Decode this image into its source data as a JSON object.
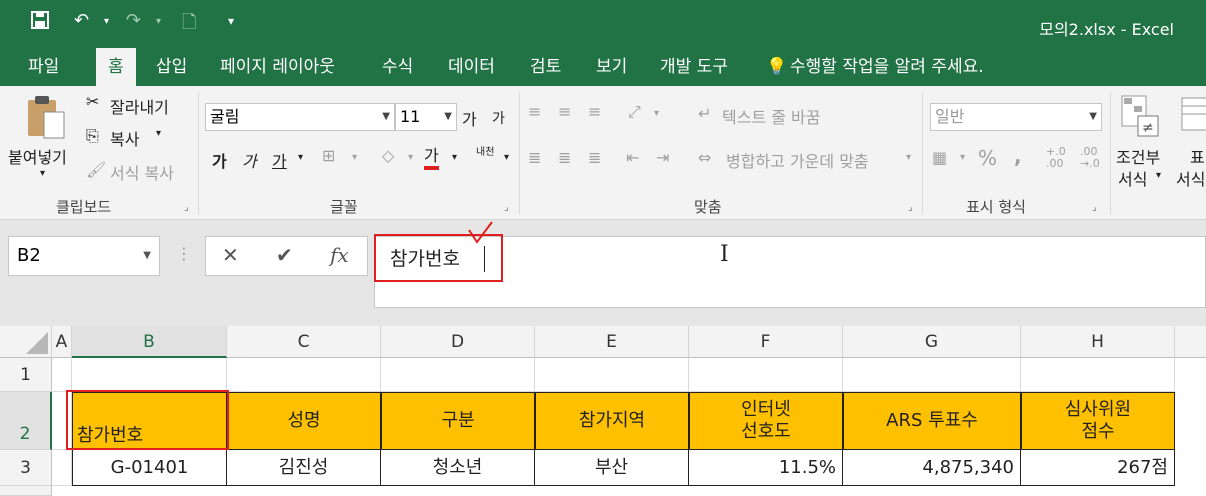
{
  "window": {
    "title": "모의2.xlsx - Excel"
  },
  "quick_access": {
    "save_icon": "save-icon",
    "undo_icon": "undo-icon",
    "redo_icon": "redo-icon",
    "preview_icon": "print-preview-icon",
    "customize_icon": "customize-icon"
  },
  "tabs": [
    "파일",
    "홈",
    "삽입",
    "페이지 레이아웃",
    "수식",
    "데이터",
    "검토",
    "보기",
    "개발 도구"
  ],
  "tell_me": "수행할 작업을 알려 주세요.",
  "ribbon": {
    "clipboard": {
      "paste": "붙여넣기",
      "cut": "잘라내기",
      "copy": "복사",
      "format_painter": "서식 복사",
      "label": "클립보드"
    },
    "font": {
      "name": "굴림",
      "size": "11",
      "grow": "가",
      "shrink": "가",
      "bold": "가",
      "italic": "가",
      "underline": "가",
      "font_color": "가",
      "phonetic": "내천",
      "label": "글꼴"
    },
    "alignment": {
      "wrap_text": "텍스트 줄 바꿈",
      "merge_center": "병합하고 가운데 맞춤",
      "label": "맞춤"
    },
    "number": {
      "format": "일반",
      "percent": "%",
      "comma": ",",
      "inc_decimal": "+.0 .00",
      "dec_decimal": ".00 →.0",
      "label": "표시 형식"
    },
    "styles": {
      "conditional_line1": "조건부",
      "conditional_line2": "서식",
      "table_line1": "표",
      "table_line2": "서식"
    }
  },
  "formula_bar": {
    "name_box": "B2",
    "cancel": "✕",
    "enter": "✔",
    "fx": "fx",
    "content": "참가번호"
  },
  "columns": [
    "A",
    "B",
    "C",
    "D",
    "E",
    "F",
    "G",
    "H"
  ],
  "rows": [
    "1",
    "2",
    "3"
  ],
  "header_row": [
    "참가번호",
    "성명",
    "구분",
    "참가지역",
    "인터넷\n선호도",
    "ARS 투표수",
    "심사위원\n점수"
  ],
  "data_row": [
    "G-01401",
    "김진성",
    "청소년",
    "부산",
    "11.5%",
    "4,875,340",
    "267점"
  ],
  "colors": {
    "excel_green": "#217346",
    "header_fill": "#ffc000",
    "annotation_red": "#e02020"
  }
}
